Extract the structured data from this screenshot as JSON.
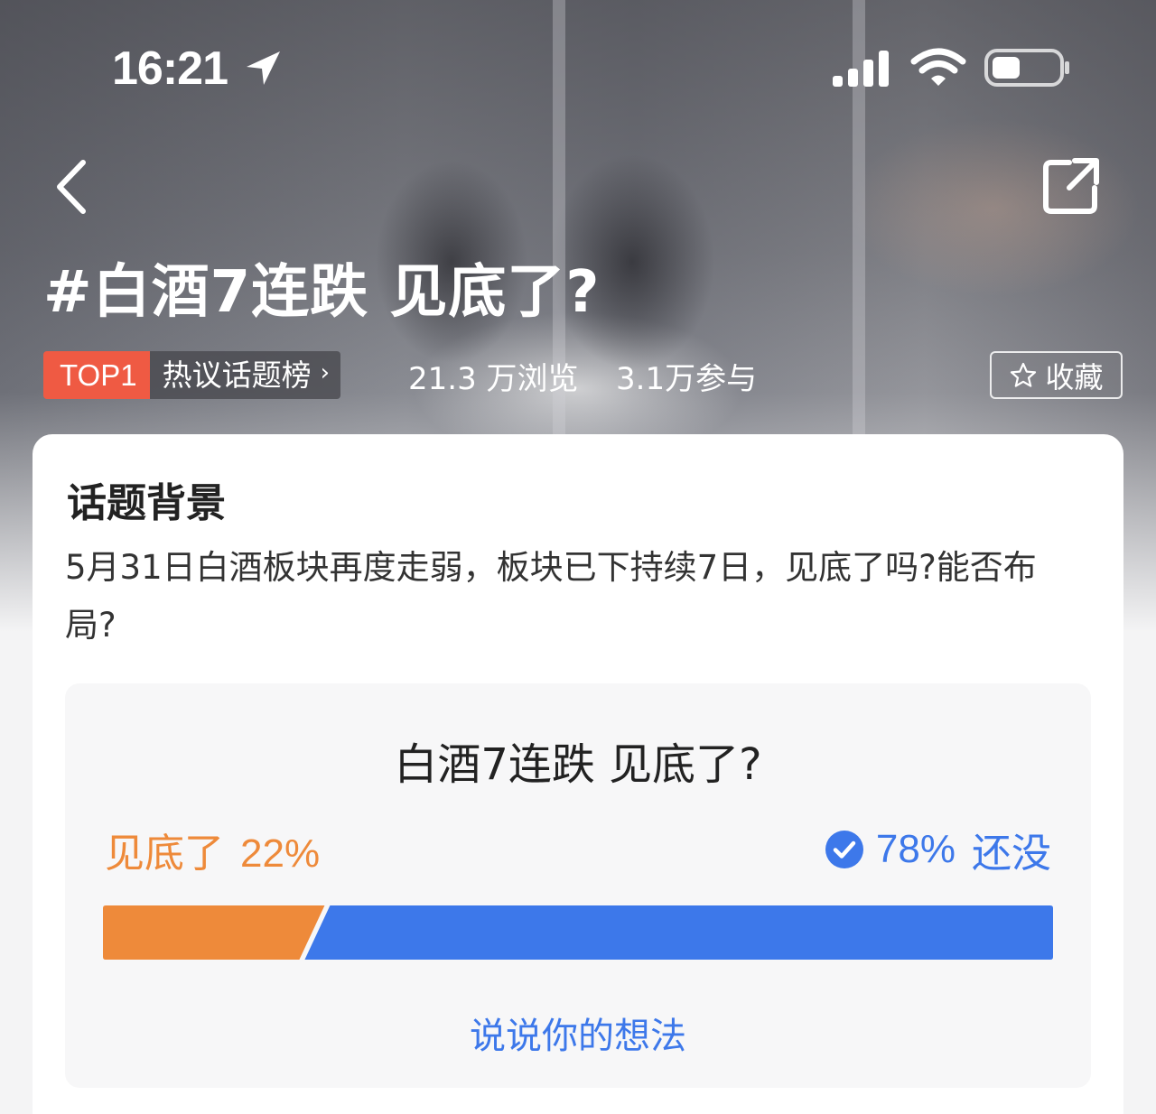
{
  "status_bar": {
    "time": "16:21"
  },
  "topic": {
    "title": "#白酒7连跌 见底了?",
    "rank_badge": "TOP1",
    "rank_list": "热议话题榜",
    "views": "21.3 万浏览",
    "participants": "3.1万参与",
    "favorite_label": "收藏"
  },
  "background": {
    "heading": "话题背景",
    "text": "5月31日白酒板块再度走弱，板块已下持续7日，见底了吗?能否布局?"
  },
  "poll": {
    "title": "白酒7连跌 见底了?",
    "options": [
      {
        "label": "见底了",
        "percent_text": "22%",
        "percent": 22,
        "color": "#ee8a3a",
        "selected": false
      },
      {
        "label": "还没",
        "percent_text": "78%",
        "percent": 78,
        "color": "#3d78ea",
        "selected": true
      }
    ],
    "comment_link": "说说你的想法"
  },
  "icons": [
    "location-arrow-icon",
    "signal-icon",
    "wifi-icon",
    "battery-icon",
    "back-icon",
    "share-icon",
    "star-icon",
    "check-icon"
  ]
}
